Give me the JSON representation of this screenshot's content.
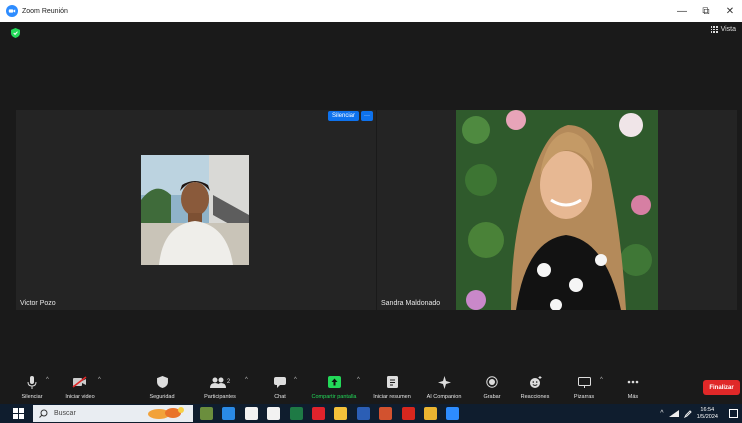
{
  "window": {
    "title": "Zoom Reunión",
    "controls": {
      "minimize": "—",
      "restore": "⧉",
      "close": "✕"
    }
  },
  "meeting": {
    "view_label": "Vista",
    "participants": [
      {
        "name": "Victor Pozo",
        "actions": {
          "mute_label": "Silenciar",
          "more_label": "···"
        }
      },
      {
        "name": "Sandra Maldonado"
      }
    ]
  },
  "toolbar": {
    "items": [
      {
        "label": "Silenciar",
        "icon": "microphone-icon"
      },
      {
        "label": "Iniciar video",
        "icon": "video-off-icon"
      },
      {
        "label": "Seguridad",
        "icon": "shield-icon"
      },
      {
        "label": "Participantes",
        "icon": "participants-icon",
        "count": "2"
      },
      {
        "label": "Chat",
        "icon": "chat-icon"
      },
      {
        "label": "Compartir pantalla",
        "icon": "share-screen-icon"
      },
      {
        "label": "Iniciar resumen",
        "icon": "summary-icon"
      },
      {
        "label": "AI Companion",
        "icon": "sparkle-icon"
      },
      {
        "label": "Grabar",
        "icon": "record-icon"
      },
      {
        "label": "Reacciones",
        "icon": "reactions-icon"
      },
      {
        "label": "Pizarras",
        "icon": "whiteboard-icon"
      },
      {
        "label": "Más",
        "icon": "more-icon"
      }
    ],
    "end_label": "Finalizar",
    "share_color": "#23d959",
    "end_color": "#e02828"
  },
  "taskbar": {
    "search_placeholder": "Buscar",
    "apps": [
      {
        "name": "minecraft-app-icon",
        "color": "#6b8e3d"
      },
      {
        "name": "store-app-icon",
        "color": "#2a8ae6"
      },
      {
        "name": "file-app-icon",
        "color": "#f2f2f2"
      },
      {
        "name": "document-app-icon",
        "color": "#f2f2f2"
      },
      {
        "name": "excel-app-icon",
        "color": "#1e7a45"
      },
      {
        "name": "opera-app-icon",
        "color": "#e0232c"
      },
      {
        "name": "explorer-app-icon",
        "color": "#f3c13a"
      },
      {
        "name": "word-app-icon",
        "color": "#2b5eb5"
      },
      {
        "name": "powerpoint-app-icon",
        "color": "#d2522f"
      },
      {
        "name": "acrobat-app-icon",
        "color": "#d7271e"
      },
      {
        "name": "chrome-app-icon",
        "color": "#e9b431"
      },
      {
        "name": "zoom-app-icon",
        "color": "#2d8cff"
      }
    ],
    "clock": {
      "time": "16:54",
      "date": "1/5/2024"
    }
  }
}
